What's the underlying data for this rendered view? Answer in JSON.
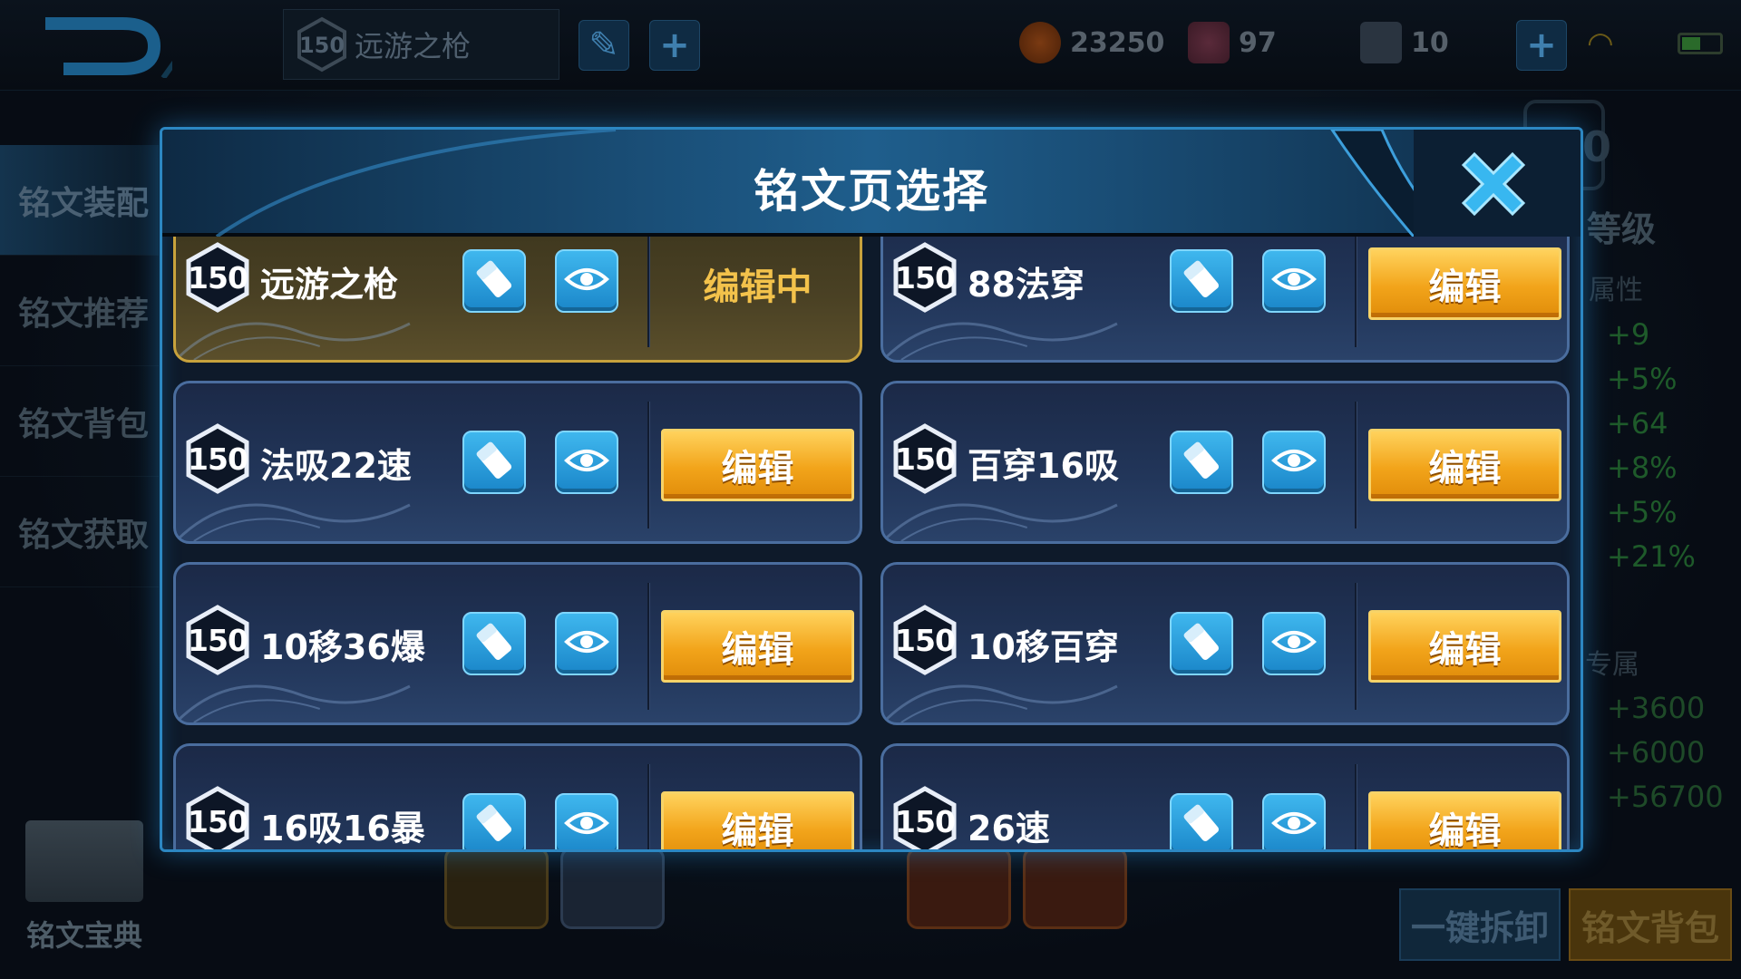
{
  "topbar": {
    "current_page": {
      "level": "150",
      "name": "远游之枪"
    },
    "currencies": [
      {
        "icon": "gold-coin-icon",
        "value": "23250"
      },
      {
        "icon": "diamond-icon",
        "value": "97"
      },
      {
        "icon": "voucher-icon",
        "value": "10"
      }
    ]
  },
  "sidebar": {
    "items": [
      {
        "label": "铭文装配",
        "active": true
      },
      {
        "label": "铭文推荐",
        "active": false
      },
      {
        "label": "铭文背包",
        "active": false
      },
      {
        "label": "铭文获取",
        "active": false
      }
    ],
    "book_label": "铭文宝典"
  },
  "right_panel": {
    "level_digit": "0",
    "level_label": "等级",
    "attr_label": "属性",
    "attr_values": [
      "+9",
      "+5%",
      "+64",
      "+8%",
      "+5%",
      "+21%"
    ],
    "exclusive_label": "专属",
    "exclusive_values": [
      "+3600",
      "+6000",
      "+56700"
    ]
  },
  "bottom_buttons": {
    "unequip_all": "一键拆卸",
    "rune_bag": "铭文背包"
  },
  "modal": {
    "title": "铭文页选择",
    "edit_label": "编辑",
    "editing_label": "编辑中",
    "pages": [
      {
        "level": "150",
        "name": "远游之枪",
        "current": true
      },
      {
        "level": "150",
        "name": "88法穿",
        "current": false
      },
      {
        "level": "150",
        "name": "法吸22速",
        "current": false
      },
      {
        "level": "150",
        "name": "百穿16吸",
        "current": false
      },
      {
        "level": "150",
        "name": "10移36爆",
        "current": false
      },
      {
        "level": "150",
        "name": "10移百穿",
        "current": false
      },
      {
        "level": "150",
        "name": "16吸16暴",
        "current": false
      },
      {
        "level": "150",
        "name": "26速",
        "current": false
      }
    ]
  },
  "colors": {
    "accent_blue": "#2c87c2",
    "edit_button": "#f2a41a",
    "current_card_border": "#c8a23c",
    "editing_text": "#f3c24b"
  }
}
